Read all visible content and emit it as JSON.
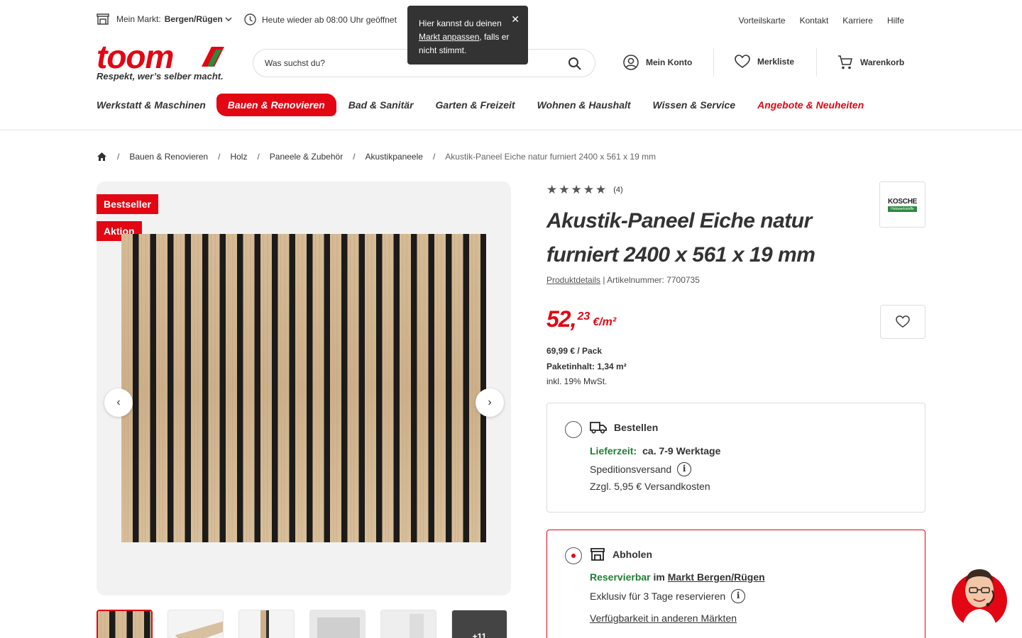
{
  "topbar": {
    "store_label": "Mein Markt:",
    "store_value": "Bergen/Rügen",
    "opening": "Heute wieder ab 08:00 Uhr geöffnet",
    "links": [
      "Vorteilskarte",
      "Kontakt",
      "Karriere",
      "Hilfe"
    ]
  },
  "tooltip": {
    "text_before": "Hier kannst du deinen",
    "link": "Markt anpassen",
    "text_after": ", falls er nicht stimmt."
  },
  "logo": {
    "word": "toom",
    "slogan": "Respekt, wer’s selber macht."
  },
  "search": {
    "placeholder": "Was suchst du?"
  },
  "header": {
    "account": "Mein Konto",
    "wishlist": "Merkliste",
    "cart": "Warenkorb"
  },
  "nav": [
    "Werkstatt & Maschinen",
    "Bauen & Renovieren",
    "Bad & Sanitär",
    "Garten & Freizeit",
    "Wohnen & Haushalt",
    "Wissen & Service",
    "Angebote & Neuheiten"
  ],
  "breadcrumb": [
    "Bauen & Renovieren",
    "Holz",
    "Paneele & Zubehör",
    "Akustikpaneele",
    "Akustik-Paneel Eiche natur furniert 2400 x 561 x 19 mm"
  ],
  "badges": [
    "Bestseller",
    "Aktion"
  ],
  "thumbs_more": "+11",
  "product": {
    "rating_count": "(4)",
    "title": "Akustik-Paneel Eiche natur furniert 2400 x 561 x 19 mm",
    "details_link": "Produktdetails",
    "article": " | Artikelnummer: 7700735",
    "brand_name": "KOSCHE",
    "brand_sub": "Holzwerkstoffe",
    "price_main": "52,",
    "price_cents": "23",
    "price_unit": "€/m²",
    "pack_price": "69,99 € / Pack",
    "pack_content": "Paketinhalt: 1,34 m²",
    "tax": "inkl. 19% MwSt."
  },
  "delivery": {
    "title": "Bestellen",
    "time_label": "Lieferzeit:",
    "time_value": "ca. 7-9 Werktage",
    "shipping": "Speditionsversand",
    "cost": "Zzgl. 5,95 € Versandkosten"
  },
  "pickup": {
    "title": "Abholen",
    "reservable": "Reservierbar",
    "im": " im ",
    "market": "Markt Bergen/Rügen",
    "exclusive": "Exklusiv für 3 Tage reservieren",
    "other": "Verfügbarkeit in anderen Märkten"
  },
  "colors": {
    "brand_red": "#e30613",
    "green": "#1e7f34"
  }
}
